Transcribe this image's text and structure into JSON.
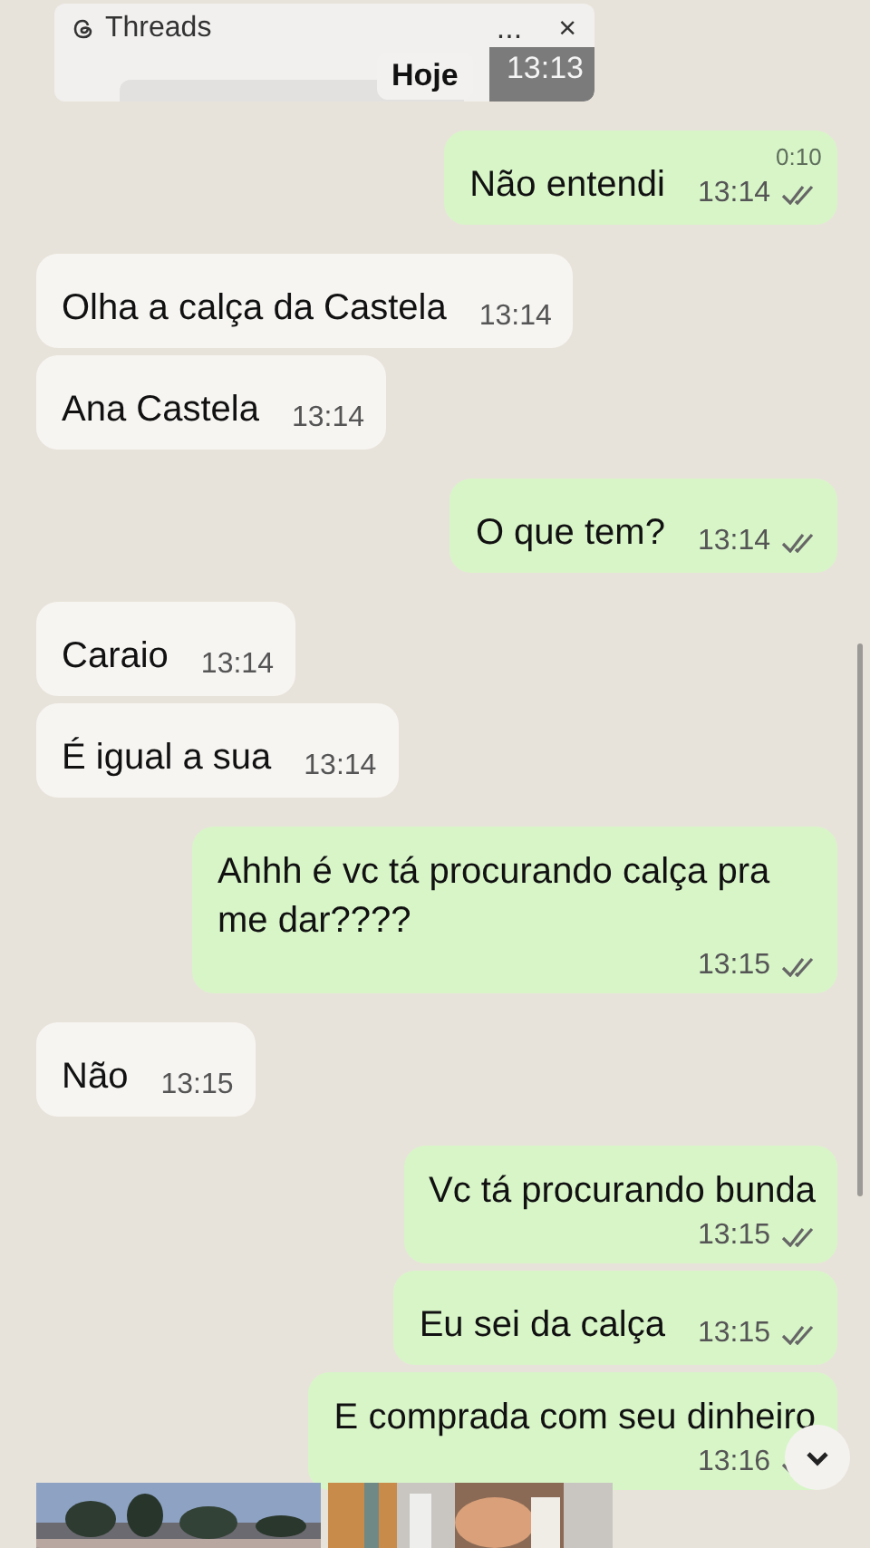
{
  "threads_popup": {
    "app": "Threads",
    "more": "...",
    "close": "×",
    "time": "13:13"
  },
  "date_chip": "Hoje",
  "video_timer": "0:10",
  "messages": [
    {
      "outgoing": true,
      "kind": "inline",
      "text": "Não entendi",
      "time": "13:14",
      "read": false
    },
    {
      "outgoing": false,
      "kind": "inline",
      "text": "Olha a calça da Castela",
      "time": "13:14"
    },
    {
      "outgoing": false,
      "kind": "inline",
      "text": "Ana Castela",
      "time": "13:14"
    },
    {
      "outgoing": true,
      "kind": "inline",
      "text": "O que tem?",
      "time": "13:14",
      "read": false
    },
    {
      "outgoing": false,
      "kind": "inline",
      "text": "Caraio",
      "time": "13:14"
    },
    {
      "outgoing": false,
      "kind": "inline",
      "text": "É igual a sua",
      "time": "13:14"
    },
    {
      "outgoing": true,
      "kind": "wrapped",
      "text": "Ahhh é vc tá procurando calça pra me dar????",
      "time": "13:15",
      "read": false
    },
    {
      "outgoing": false,
      "kind": "inline",
      "text": "Não",
      "time": "13:15"
    },
    {
      "outgoing": true,
      "kind": "wrapped",
      "text": "Vc tá procurando bunda",
      "time": "13:15",
      "read": false
    },
    {
      "outgoing": true,
      "kind": "inline",
      "text": "Eu sei da calça",
      "time": "13:15",
      "read": false
    },
    {
      "outgoing": true,
      "kind": "wrapped",
      "text": "E comprada com seu dinheiro",
      "time": "13:16",
      "read": false
    }
  ]
}
